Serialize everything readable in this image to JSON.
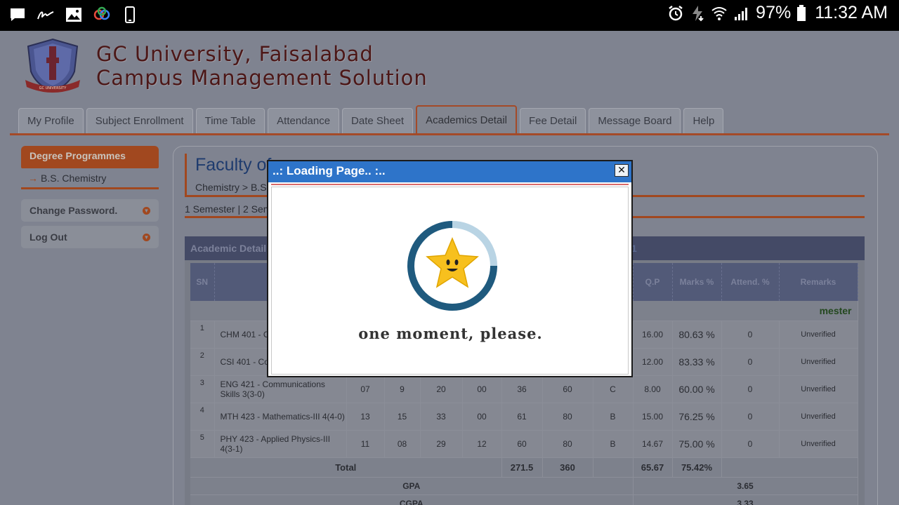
{
  "status_bar": {
    "left_icons": [
      "message-icon",
      "signature-icon",
      "gallery-icon",
      "sync-icon",
      "phone-icon"
    ],
    "battery_percent": "97%",
    "time": "11:32 AM"
  },
  "site": {
    "title_line1": "GC University, Faisalabad",
    "title_line2": "Campus Management Solution"
  },
  "tabs": [
    {
      "label": "My Profile"
    },
    {
      "label": "Subject Enrollment"
    },
    {
      "label": "Time Table"
    },
    {
      "label": "Attendance"
    },
    {
      "label": "Date Sheet"
    },
    {
      "label": "Academics Detail",
      "active": true
    },
    {
      "label": "Fee Detail"
    },
    {
      "label": "Message Board"
    },
    {
      "label": "Help"
    }
  ],
  "sidebar": {
    "heading": "Degree Programmes",
    "programme": "B.S. Chemistry",
    "change_password": "Change Password.",
    "logout": "Log Out"
  },
  "content": {
    "faculty_title": "Faculty of",
    "crumb": "Chemistry > B.S.",
    "semester_links": "1 Semester | 2 Sem",
    "detail_heading": "Academic Detail",
    "detail_heading_right": "1"
  },
  "table": {
    "headers": [
      "SN",
      "Su",
      "",
      "",
      "",
      "",
      "",
      "",
      "",
      "Q.P",
      "Marks %",
      "Attend. %",
      "Remarks"
    ],
    "semester_label": "mester",
    "rows": [
      {
        "sn": "1",
        "subject": "CHM 401 - Chemistry-I",
        "c1": "",
        "c2": "",
        "c3": "",
        "c4": "",
        "c5": "",
        "c6": "",
        "grade": "",
        "qp": "16.00",
        "marks": "80.63 %",
        "attend": "0",
        "remarks": "Unverified"
      },
      {
        "sn": "2",
        "subject": "CSI 401 - Co Application",
        "c1": "",
        "c2": "",
        "c3": "",
        "c4": "",
        "c5": "",
        "c6": "",
        "grade": "",
        "qp": "12.00",
        "marks": "83.33 %",
        "attend": "0",
        "remarks": "Unverified"
      },
      {
        "sn": "3",
        "subject": "ENG 421 - Communications Skills 3(3-0)",
        "c1": "07",
        "c2": "9",
        "c3": "20",
        "c4": "00",
        "c5": "36",
        "c6": "60",
        "grade": "C",
        "qp": "8.00",
        "marks": "60.00 %",
        "attend": "0",
        "remarks": "Unverified"
      },
      {
        "sn": "4",
        "subject": "MTH 423 - Mathematics-III 4(4-0)",
        "c1": "13",
        "c2": "15",
        "c3": "33",
        "c4": "00",
        "c5": "61",
        "c6": "80",
        "grade": "B",
        "qp": "15.00",
        "marks": "76.25 %",
        "attend": "0",
        "remarks": "Unverified"
      },
      {
        "sn": "5",
        "subject": "PHY 423 - Applied Physics-III 4(3-1)",
        "c1": "11",
        "c2": "08",
        "c3": "29",
        "c4": "12",
        "c5": "60",
        "c6": "80",
        "grade": "B",
        "qp": "14.67",
        "marks": "75.00 %",
        "attend": "0",
        "remarks": "Unverified"
      }
    ],
    "total_label": "Total",
    "total_obtained": "271.5",
    "total_max": "360",
    "total_qp": "65.67",
    "total_percent": "75.42%",
    "gpa_label": "GPA",
    "gpa_value": "3.65",
    "cgpa_label": "CGPA",
    "cgpa_value": "3.33"
  },
  "modal": {
    "title": "..: Loading Page.. :..",
    "close_symbol": "✕",
    "message": "one moment, please."
  },
  "colors": {
    "modal_titlebar": "#2e74c9",
    "accent": "#a1481f",
    "overlay_page": "#7f8390"
  }
}
